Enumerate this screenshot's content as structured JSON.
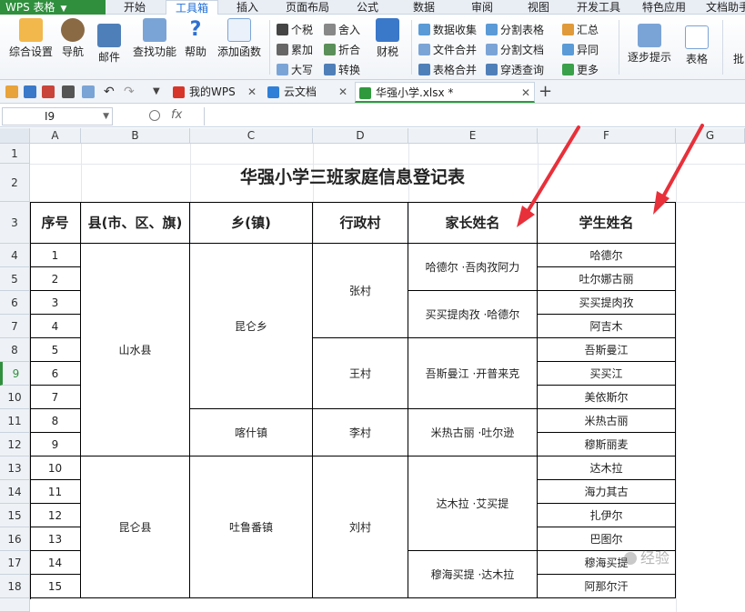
{
  "app": {
    "name": "WPS 表格"
  },
  "ribbon_tabs": [
    "开始",
    "工具箱",
    "插入",
    "页面布局",
    "公式",
    "数据",
    "审阅",
    "视图",
    "开发工具",
    "特色应用",
    "文档助手"
  ],
  "active_tab": "工具箱",
  "ribbon": {
    "big_buttons": [
      "综合设置",
      "导航",
      "邮件",
      "查找功能",
      "帮助",
      "添加函数",
      "财税",
      "逐步提示",
      "表格",
      "批"
    ],
    "small_buttons": {
      "col1": [
        "个税",
        "累加",
        "大写"
      ],
      "col2": [
        "舍入",
        "折合",
        "转换"
      ],
      "col3": [
        "数据收集",
        "文件合并",
        "表格合并"
      ],
      "col4": [
        "分割表格",
        "分割文档",
        "穿透查询"
      ],
      "col5": [
        "汇总",
        "异同",
        "更多"
      ]
    }
  },
  "doc_tabs": [
    {
      "label": "我的WPS"
    },
    {
      "label": "云文档"
    },
    {
      "label": "华强小学.xlsx *"
    }
  ],
  "formula_bar": {
    "cell_ref": "I9",
    "fx": "fx",
    "value": ""
  },
  "columns": [
    "A",
    "B",
    "C",
    "D",
    "E",
    "F",
    "G"
  ],
  "rows": [
    "1",
    "2",
    "3",
    "4",
    "5",
    "6",
    "7",
    "8",
    "9",
    "10",
    "11",
    "12",
    "13",
    "14",
    "15",
    "16",
    "17",
    "18"
  ],
  "sheet": {
    "title": "华强小学三班家庭信息登记表",
    "headers": [
      "序号",
      "县(市、区、旗)",
      "乡(镇)",
      "行政村",
      "家长姓名",
      "学生姓名"
    ],
    "seq": [
      "1",
      "2",
      "3",
      "4",
      "5",
      "6",
      "7",
      "8",
      "9",
      "10",
      "11",
      "12",
      "13",
      "14",
      "15"
    ],
    "counties": [
      "山水县",
      "昆仑县"
    ],
    "towns": [
      "昆仑乡",
      "喀什镇",
      "吐鲁番镇"
    ],
    "villages": [
      "张村",
      "王村",
      "李村",
      "刘村"
    ],
    "parents": [
      "哈德尔 ·吾肉孜阿力",
      "买买提肉孜 ·哈德尔",
      "吾斯曼江 ·开普来克",
      "米热古丽 ·吐尔逊",
      "达木拉 ·艾买提",
      "穆海买提 ·达木拉"
    ],
    "students": [
      "哈德尔",
      "吐尔娜古丽",
      "买买提肉孜",
      "阿吉木",
      "吾斯曼江",
      "买买江",
      "美依斯尔",
      "米热古丽",
      "穆斯丽麦",
      "达木拉",
      "海力其古",
      "扎伊尔",
      "巴图尔",
      "穆海买提",
      "阿那尔汗"
    ]
  },
  "watermark": "经验",
  "colors": {
    "accent": "#2f8f3d",
    "tab_active": "#1e6dd6",
    "arrow": "#e8303a"
  }
}
